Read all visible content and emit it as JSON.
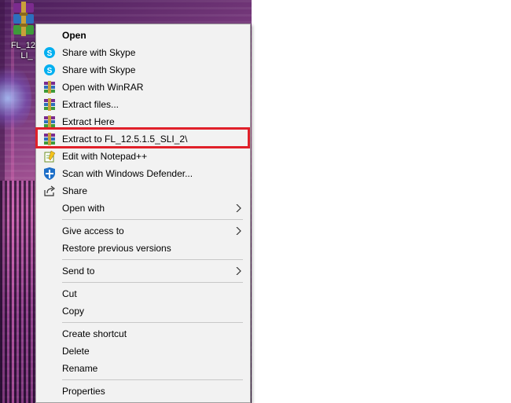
{
  "desktop": {
    "icon_label_line1": "FL_12.5",
    "icon_label_line2": "LI_"
  },
  "menu": {
    "items": [
      {
        "label": "Open",
        "icon": "none",
        "bold": true
      },
      {
        "label": "Share with Skype",
        "icon": "skype-icon"
      },
      {
        "label": "Share with Skype",
        "icon": "skype-icon"
      },
      {
        "label": "Open with WinRAR",
        "icon": "winrar-icon"
      },
      {
        "label": "Extract files...",
        "icon": "winrar-icon"
      },
      {
        "label": "Extract Here",
        "icon": "winrar-icon"
      },
      {
        "label": "Extract to FL_12.5.1.5_SLI_2\\",
        "icon": "winrar-icon"
      },
      {
        "label": "Edit with Notepad++",
        "icon": "notepad-plus-plus-icon"
      },
      {
        "label": "Scan with Windows Defender...",
        "icon": "windows-defender-icon"
      },
      {
        "label": "Share",
        "icon": "share-icon"
      },
      {
        "label": "Open with",
        "icon": "none",
        "submenu": true
      },
      {
        "label": "Give access to",
        "icon": "none",
        "submenu": true
      },
      {
        "label": "Restore previous versions",
        "icon": "none"
      },
      {
        "label": "Send to",
        "icon": "none",
        "submenu": true
      },
      {
        "label": "Cut",
        "icon": "none"
      },
      {
        "label": "Copy",
        "icon": "none"
      },
      {
        "label": "Create shortcut",
        "icon": "none"
      },
      {
        "label": "Delete",
        "icon": "none"
      },
      {
        "label": "Rename",
        "icon": "none"
      },
      {
        "label": "Properties",
        "icon": "none"
      }
    ]
  },
  "colors": {
    "menu_background": "#f2f2f2",
    "highlight_border": "#e0202a",
    "skype_blue": "#00aff0"
  }
}
